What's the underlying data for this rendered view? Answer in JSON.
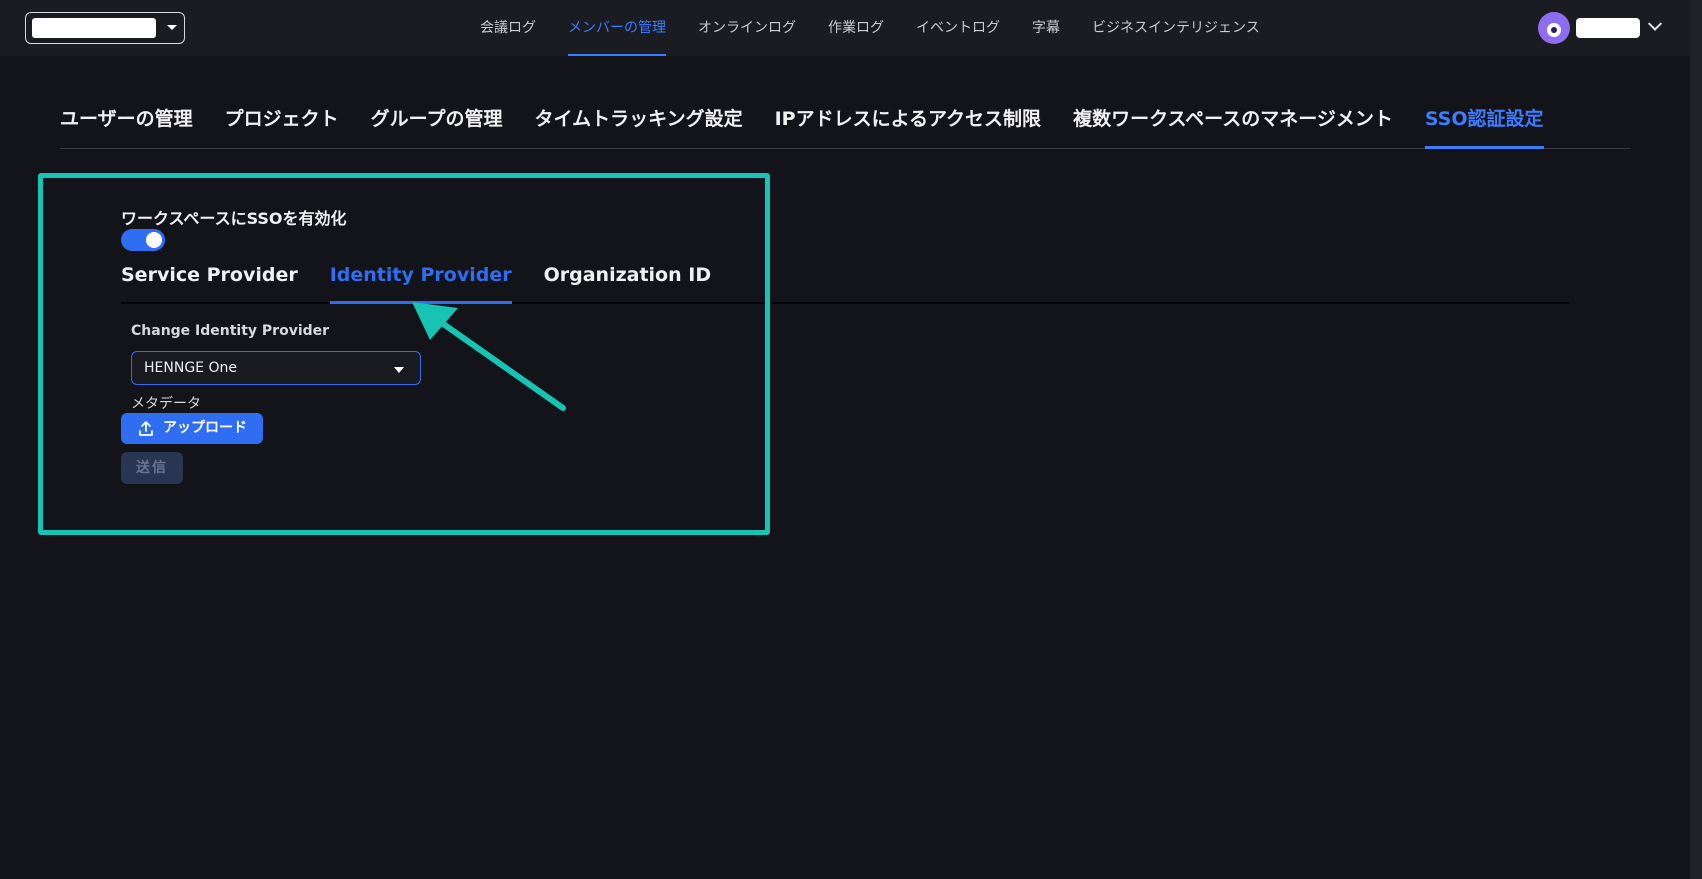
{
  "top_nav": {
    "items": [
      {
        "label": "会議ログ"
      },
      {
        "label": "メンバーの管理"
      },
      {
        "label": "オンラインログ"
      },
      {
        "label": "作業ログ"
      },
      {
        "label": "イベントログ"
      },
      {
        "label": "字幕"
      },
      {
        "label": "ビジネスインテリジェンス"
      }
    ],
    "active_index": 1
  },
  "section_tabs": {
    "items": [
      {
        "label": "ユーザーの管理"
      },
      {
        "label": "プロジェクト"
      },
      {
        "label": "グループの管理"
      },
      {
        "label": "タイムトラッキング設定"
      },
      {
        "label": "IPアドレスによるアクセス制限"
      },
      {
        "label": "複数ワークスペースのマネージメント"
      },
      {
        "label": "SSO認証設定"
      }
    ],
    "active_index": 6
  },
  "sso": {
    "toggle_label": "ワークスペースにSSOを有効化",
    "enabled": true,
    "tabs": [
      {
        "label": "Service Provider"
      },
      {
        "label": "Identity Provider"
      },
      {
        "label": "Organization ID"
      }
    ],
    "active_tab_index": 1,
    "provider_label": "Change Identity Provider",
    "provider_value": "HENNGE One",
    "metadata_label": "メタデータ",
    "upload_label": "アップロード",
    "submit_label": "送信"
  },
  "colors": {
    "background": "#13141a",
    "accent": "#2f6df2",
    "annotation": "#17c3b2"
  }
}
